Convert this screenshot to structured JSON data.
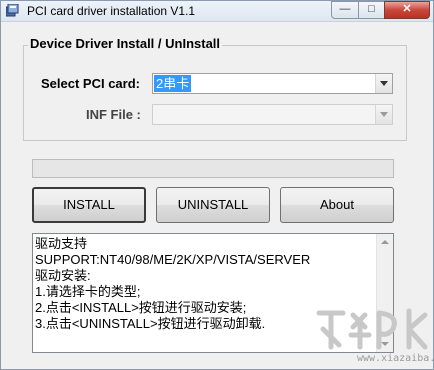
{
  "window": {
    "title": "PCI card driver installation V1.1",
    "min_label": "—",
    "max_label": "□",
    "close_label": "✕"
  },
  "group": {
    "title": "Device Driver Install / UnInstall",
    "pci_label": "Select PCI card:",
    "pci_value": "2串卡",
    "inf_label": "INF File :",
    "inf_value": ""
  },
  "progress": {
    "value": 0
  },
  "buttons": {
    "install": "INSTALL",
    "uninstall": "UNINSTALL",
    "about": "About"
  },
  "info": {
    "lines": [
      "驱动支持",
      "SUPPORT:NT40/98/ME/2K/XP/VISTA/SERVER",
      "驱动安装:",
      "1.请选择卡的类型;",
      "2.点击<INSTALL>按钮进行驱动安装;",
      "3.点击<UNINSTALL>按钮进行驱动卸载."
    ]
  },
  "watermark": {
    "text": "www.xiazaiba.com"
  },
  "icons": {
    "app": "app-icon",
    "scroll_up": "scroll-up-arrow-icon",
    "scroll_down": "scroll-down-arrow-icon",
    "dropdown": "chevron-down-icon"
  },
  "colors": {
    "selection": "#3399ff",
    "progress": "#06b025",
    "close_button": "#c8473a"
  }
}
